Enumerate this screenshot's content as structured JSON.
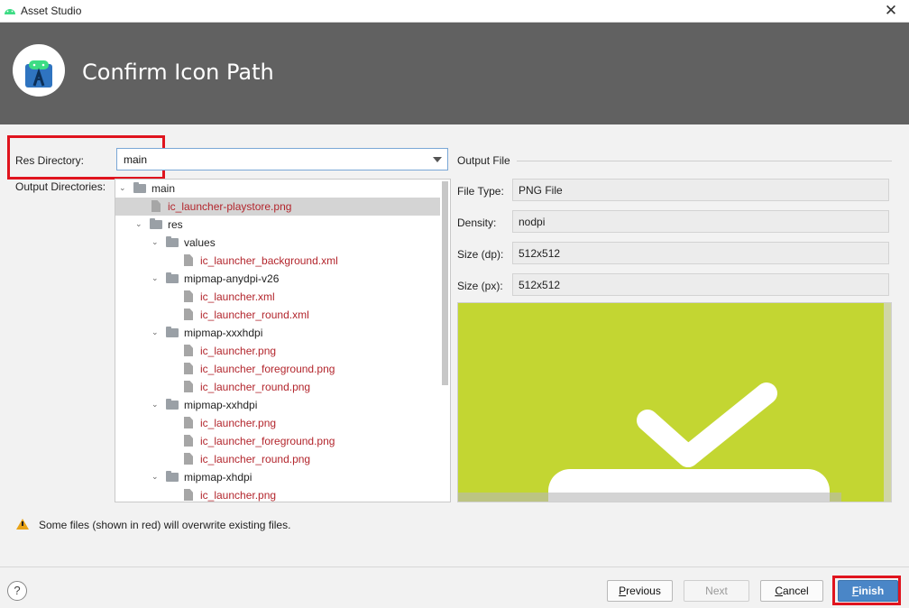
{
  "window": {
    "title": "Asset Studio",
    "app_icon": "android-icon",
    "close_icon": "close-icon"
  },
  "header": {
    "title": "Confirm Icon Path",
    "logo": "android-studio-icon"
  },
  "form": {
    "res_directory_label": "Res Directory:",
    "res_directory_value": "main",
    "output_directories_label": "Output Directories:"
  },
  "tree": [
    {
      "label": "main",
      "type": "folder",
      "expanded": true,
      "level": 0,
      "overwrite": false
    },
    {
      "label": "ic_launcher-playstore.png",
      "type": "file",
      "level": 1,
      "overwrite": true,
      "selected": true
    },
    {
      "label": "res",
      "type": "folder",
      "expanded": true,
      "level": 1,
      "overwrite": false
    },
    {
      "label": "values",
      "type": "folder",
      "expanded": true,
      "level": 2,
      "overwrite": false
    },
    {
      "label": "ic_launcher_background.xml",
      "type": "file",
      "level": 3,
      "overwrite": true
    },
    {
      "label": "mipmap-anydpi-v26",
      "type": "folder",
      "expanded": true,
      "level": 2,
      "overwrite": false
    },
    {
      "label": "ic_launcher.xml",
      "type": "file",
      "level": 3,
      "overwrite": true
    },
    {
      "label": "ic_launcher_round.xml",
      "type": "file",
      "level": 3,
      "overwrite": true
    },
    {
      "label": "mipmap-xxxhdpi",
      "type": "folder",
      "expanded": true,
      "level": 2,
      "overwrite": false
    },
    {
      "label": "ic_launcher.png",
      "type": "file",
      "level": 3,
      "overwrite": true
    },
    {
      "label": "ic_launcher_foreground.png",
      "type": "file",
      "level": 3,
      "overwrite": true
    },
    {
      "label": "ic_launcher_round.png",
      "type": "file",
      "level": 3,
      "overwrite": true
    },
    {
      "label": "mipmap-xxhdpi",
      "type": "folder",
      "expanded": true,
      "level": 2,
      "overwrite": false
    },
    {
      "label": "ic_launcher.png",
      "type": "file",
      "level": 3,
      "overwrite": true
    },
    {
      "label": "ic_launcher_foreground.png",
      "type": "file",
      "level": 3,
      "overwrite": true
    },
    {
      "label": "ic_launcher_round.png",
      "type": "file",
      "level": 3,
      "overwrite": true
    },
    {
      "label": "mipmap-xhdpi",
      "type": "folder",
      "expanded": true,
      "level": 2,
      "overwrite": false
    },
    {
      "label": "ic_launcher.png",
      "type": "file",
      "level": 3,
      "overwrite": true
    }
  ],
  "output": {
    "heading": "Output File",
    "file_type_label": "File Type:",
    "file_type_value": "PNG File",
    "density_label": "Density:",
    "density_value": "nodpi",
    "size_dp_label": "Size (dp):",
    "size_dp_value": "512x512",
    "size_px_label": "Size (px):",
    "size_px_value": "512x512",
    "preview_color": "#c3d632"
  },
  "warning": {
    "icon": "warning-icon",
    "text": "Some files (shown in red) will overwrite existing files."
  },
  "buttons": {
    "help": "?",
    "previous_pre": "",
    "previous_key": "P",
    "previous_post": "revious",
    "next": "Next",
    "cancel_pre": "",
    "cancel_key": "C",
    "cancel_post": "ancel",
    "finish_pre": "",
    "finish_key": "F",
    "finish_post": "inish"
  },
  "colors": {
    "overwrite_text": "#b3262d",
    "header_bg": "#616161",
    "highlight": "#e0141e",
    "primary_button": "#4a86c7"
  }
}
